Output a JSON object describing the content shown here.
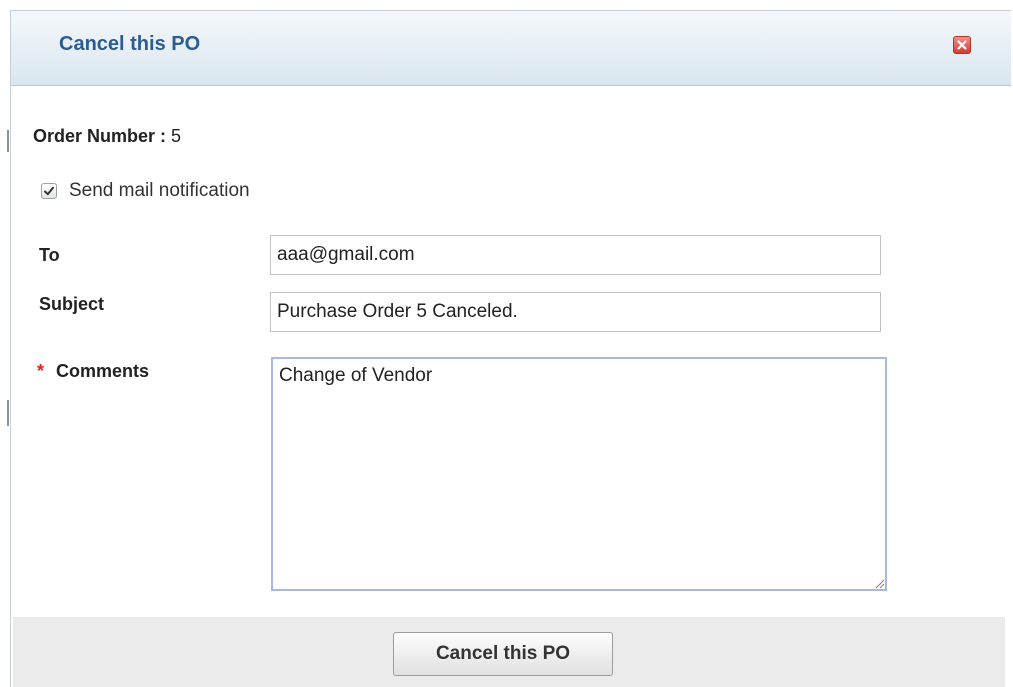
{
  "dialog": {
    "title": "Cancel this PO"
  },
  "order": {
    "label": "Order Number :",
    "value": "5"
  },
  "notification": {
    "checked": true,
    "label": "Send mail notification"
  },
  "fields": {
    "to_label": "To",
    "to_value": "aaa@gmail.com",
    "subject_label": "Subject",
    "subject_value": "Purchase Order 5 Canceled.",
    "comments_required_mark": "*",
    "comments_label": "Comments",
    "comments_value": "Change of Vendor"
  },
  "footer": {
    "submit_label": "Cancel this PO"
  },
  "icons": {
    "close": "close-icon",
    "check": "checkmark-icon",
    "resize": "resize-grip-icon"
  },
  "colors": {
    "title": "#2d5c8f",
    "close_button": "#d33c33",
    "required": "#e02020",
    "comments_border": "#a8b8e6"
  }
}
